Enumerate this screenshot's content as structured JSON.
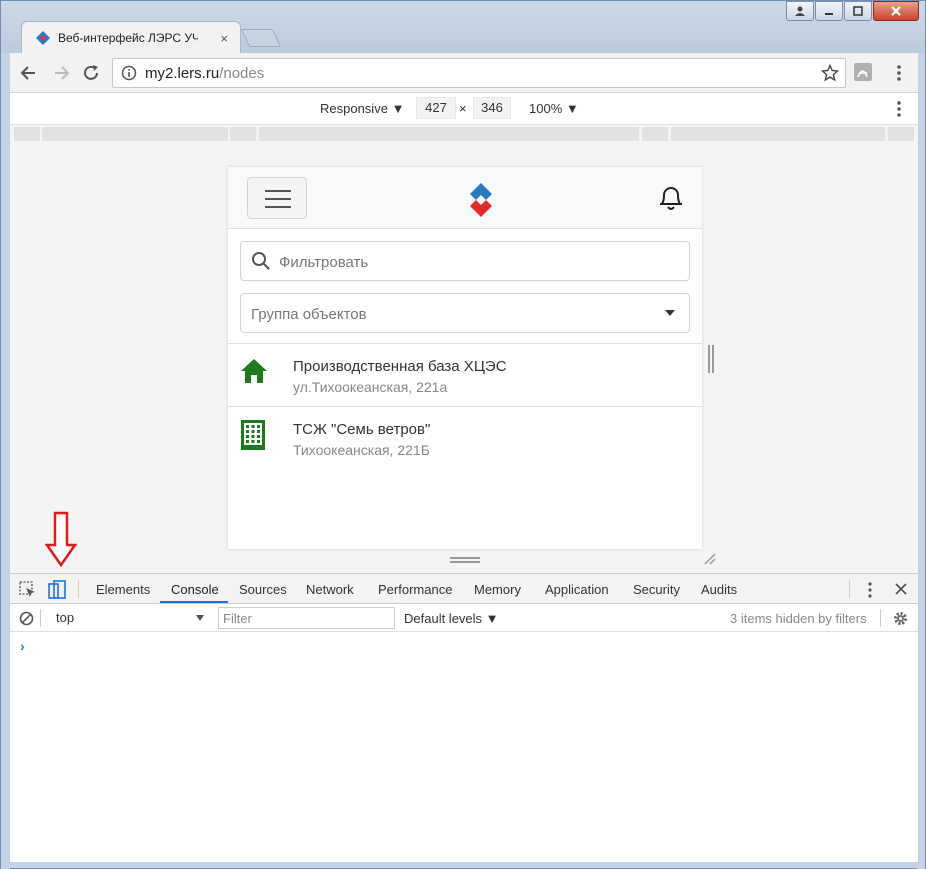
{
  "window": {
    "tab_title": "Веб-интерфейс ЛЭРС УЧ",
    "tab_close": "×"
  },
  "toolbar": {
    "url_host": "my2.lers.ru",
    "url_path": "/nodes"
  },
  "responsive": {
    "mode": "Responsive",
    "width": "427",
    "times": "×",
    "height": "346",
    "zoom": "100%"
  },
  "app": {
    "filter_placeholder": "Фильтровать",
    "group_placeholder": "Группа объектов",
    "items": [
      {
        "title": "Производственная база ХЦЭС",
        "address": "ул.Тихоокеанская, 221а",
        "icon": "house-icon"
      },
      {
        "title": "ТСЖ \"Семь ветров\"",
        "address": "Тихоокеанская, 221Б",
        "icon": "building-icon"
      }
    ]
  },
  "devtools": {
    "tabs": [
      "Elements",
      "Console",
      "Sources",
      "Network",
      "Performance",
      "Memory",
      "Application",
      "Security",
      "Audits"
    ],
    "active_tab": "Console",
    "context": "top",
    "filter_placeholder": "Filter",
    "levels": "Default levels",
    "hidden_info": "3 items hidden by filters",
    "prompt": "›"
  },
  "colors": {
    "accent": "#1a73e8",
    "icon_green": "#1e7a1e",
    "arrow_red": "#e01b1b"
  }
}
